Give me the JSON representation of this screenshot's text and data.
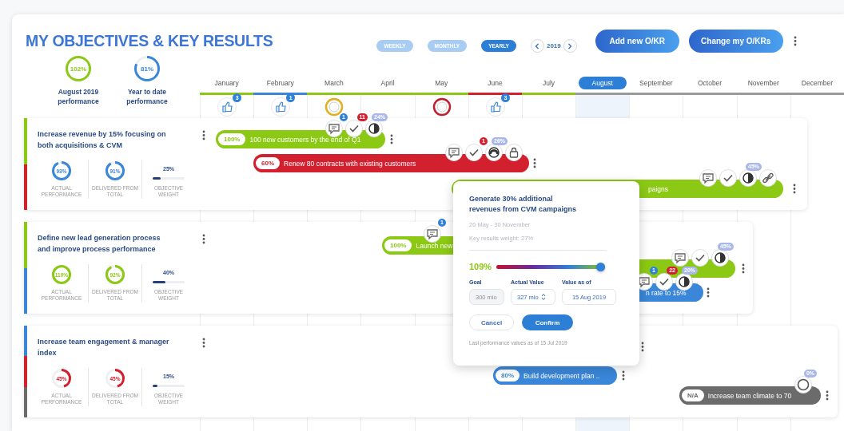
{
  "title": "MY OBJECTIVES & KEY RESULTS",
  "view_tabs": [
    {
      "label": "WEEKLY",
      "selected": false
    },
    {
      "label": "MONTHLY",
      "selected": false
    },
    {
      "label": "YEARLY",
      "selected": true
    }
  ],
  "year": "2019",
  "buttons": [
    "Add new O/KR",
    "Change my O/KRs"
  ],
  "summary": [
    {
      "value": "102%",
      "color": "#8cc914",
      "label": "August 2019 performance"
    },
    {
      "value": "81%",
      "color": "#3a86d8",
      "label": "Year to date performance"
    }
  ],
  "months": [
    {
      "name": "January",
      "selected": false,
      "color": "#8cc914",
      "event": {
        "kind": "thumbs-up",
        "badge": "3"
      }
    },
    {
      "name": "February",
      "selected": false,
      "color": "#3a86d8",
      "event": {
        "kind": "thumbs-up",
        "badge": "1"
      }
    },
    {
      "name": "March",
      "selected": false,
      "color": "#8cc914",
      "event": {
        "kind": "medal",
        "color": "#e0b020"
      }
    },
    {
      "name": "April",
      "selected": false,
      "color": "#8cc914"
    },
    {
      "name": "May",
      "selected": false,
      "color": "#8cc914",
      "event": {
        "kind": "medal",
        "color": "#c0202e"
      }
    },
    {
      "name": "June",
      "selected": false,
      "color": "#d2202f",
      "event": {
        "kind": "thumbs-up",
        "badge": "3"
      }
    },
    {
      "name": "July",
      "selected": false,
      "color": "#8cc914"
    },
    {
      "name": "August",
      "selected": true,
      "color": "#9a9a9a"
    },
    {
      "name": "September",
      "selected": false,
      "color": "#9a9a9a"
    },
    {
      "name": "October",
      "selected": false,
      "color": "#9a9a9a"
    },
    {
      "name": "November",
      "selected": false,
      "color": "#9a9a9a"
    },
    {
      "name": "December",
      "selected": false,
      "color": "#9a9a9a"
    }
  ],
  "objectives": [
    {
      "title": "Increase revenue by 15% focusing on both acquisitions & CVM",
      "stripe": [
        {
          "color": "#8cc914"
        },
        {
          "color": "#d2202f"
        }
      ],
      "actual": {
        "value": "93%",
        "color": "#3a86d8",
        "label": "ACTUAL PERFORMANCE"
      },
      "delivered": {
        "value": "91%",
        "color": "#3a86d8",
        "label": "DELIVERED FROM TOTAL"
      },
      "weight": {
        "value": "25%",
        "level": 0.25,
        "label": "OBJECTIVE WEIGHT"
      },
      "key_results": [
        {
          "percent": "100%",
          "label": "100 new customers by the end of Q1",
          "color": "#8cc914",
          "icons": [
            {
              "kind": "comment",
              "badge": "1"
            },
            {
              "kind": "check",
              "badge": "11"
            },
            {
              "kind": "pie",
              "badge": "24%"
            }
          ]
        },
        {
          "percent": "60%",
          "label": "Renew 80 contracts with existing customers",
          "color": "#d2202f",
          "icons": [
            {
              "kind": "comment"
            },
            {
              "kind": "check",
              "badge": "1"
            },
            {
              "kind": "gauge",
              "badge": "26%"
            },
            {
              "kind": "lock"
            }
          ]
        },
        {
          "label": "paigns",
          "color": "#8cc914",
          "icons": [
            {
              "kind": "comment"
            },
            {
              "kind": "check"
            },
            {
              "kind": "pie",
              "badge": "45%"
            },
            {
              "kind": "link"
            }
          ]
        }
      ]
    },
    {
      "title": "Define new lead generation process and improve process performance",
      "stripe": [
        {
          "color": "#8cc914"
        },
        {
          "color": "#3a86d8"
        }
      ],
      "actual": {
        "value": "110%",
        "color": "#8cc914",
        "label": "ACTUAL PERFORMANCE"
      },
      "delivered": {
        "value": "92%",
        "color": "#8cc914",
        "label": "DELIVERED FROM TOTAL"
      },
      "weight": {
        "value": "40%",
        "level": 0.4,
        "label": "OBJECTIVE WEIGHT"
      },
      "key_results": [
        {
          "percent": "100%",
          "label": "Launch new",
          "color": "#8cc914",
          "icons": [
            {
              "kind": "comment",
              "badge": "1"
            }
          ]
        },
        {
          "color": "#8cc914",
          "icons": [
            {
              "kind": "comment"
            },
            {
              "kind": "check"
            },
            {
              "kind": "pie",
              "badge": "45%"
            }
          ]
        },
        {
          "label": "n rate to 15%",
          "color": "#3a86d8",
          "icons": [
            {
              "kind": "comment",
              "badge": "1"
            },
            {
              "kind": "check",
              "badge": "22"
            },
            {
              "kind": "pie",
              "badge": "20%"
            }
          ]
        }
      ]
    },
    {
      "title": "Increase team engagement & manager index",
      "stripe": [
        {
          "color": "#3a86d8"
        },
        {
          "color": "#d2202f"
        },
        {
          "color": "#6b6b6b"
        }
      ],
      "actual": {
        "value": "45%",
        "color": "#d2202f",
        "label": "ACTUAL PERFORMANCE"
      },
      "delivered": {
        "value": "45%",
        "color": "#d2202f",
        "label": "DELIVERED FROM TOTAL"
      },
      "weight": {
        "value": "15%",
        "level": 0.15,
        "label": "OBJECTIVE WEIGHT"
      },
      "key_results": [
        {
          "percent": "80%",
          "label": "Build development plan ..",
          "color": "#3a86d8"
        },
        {
          "percent": "N/A",
          "label": "Increase team climate to 70",
          "color": "#6b6b6b",
          "icons": [
            {
              "kind": "ring",
              "badge": "0%"
            }
          ]
        }
      ]
    }
  ],
  "popup": {
    "title": "Generate 30% additional revenues from CVM campaigns",
    "dates": "20 May - 30 November",
    "weight": "Key results weight: 27%",
    "reading": "109%",
    "level": 1,
    "fields": [
      {
        "label": "Goal",
        "value": "300 mio",
        "disabled": true,
        "kind": "text"
      },
      {
        "label": "Actual Value",
        "value": "327 mio",
        "disabled": false,
        "kind": "spinner"
      },
      {
        "label": "Value as of",
        "value": "15 Aug 2019",
        "disabled": false,
        "kind": "text"
      }
    ],
    "buttons": [
      {
        "label": "Cancel",
        "kind": "secondary"
      },
      {
        "label": "Confirm",
        "kind": "primary"
      }
    ],
    "note": "Last performance values as of 15 Jul 2019"
  }
}
